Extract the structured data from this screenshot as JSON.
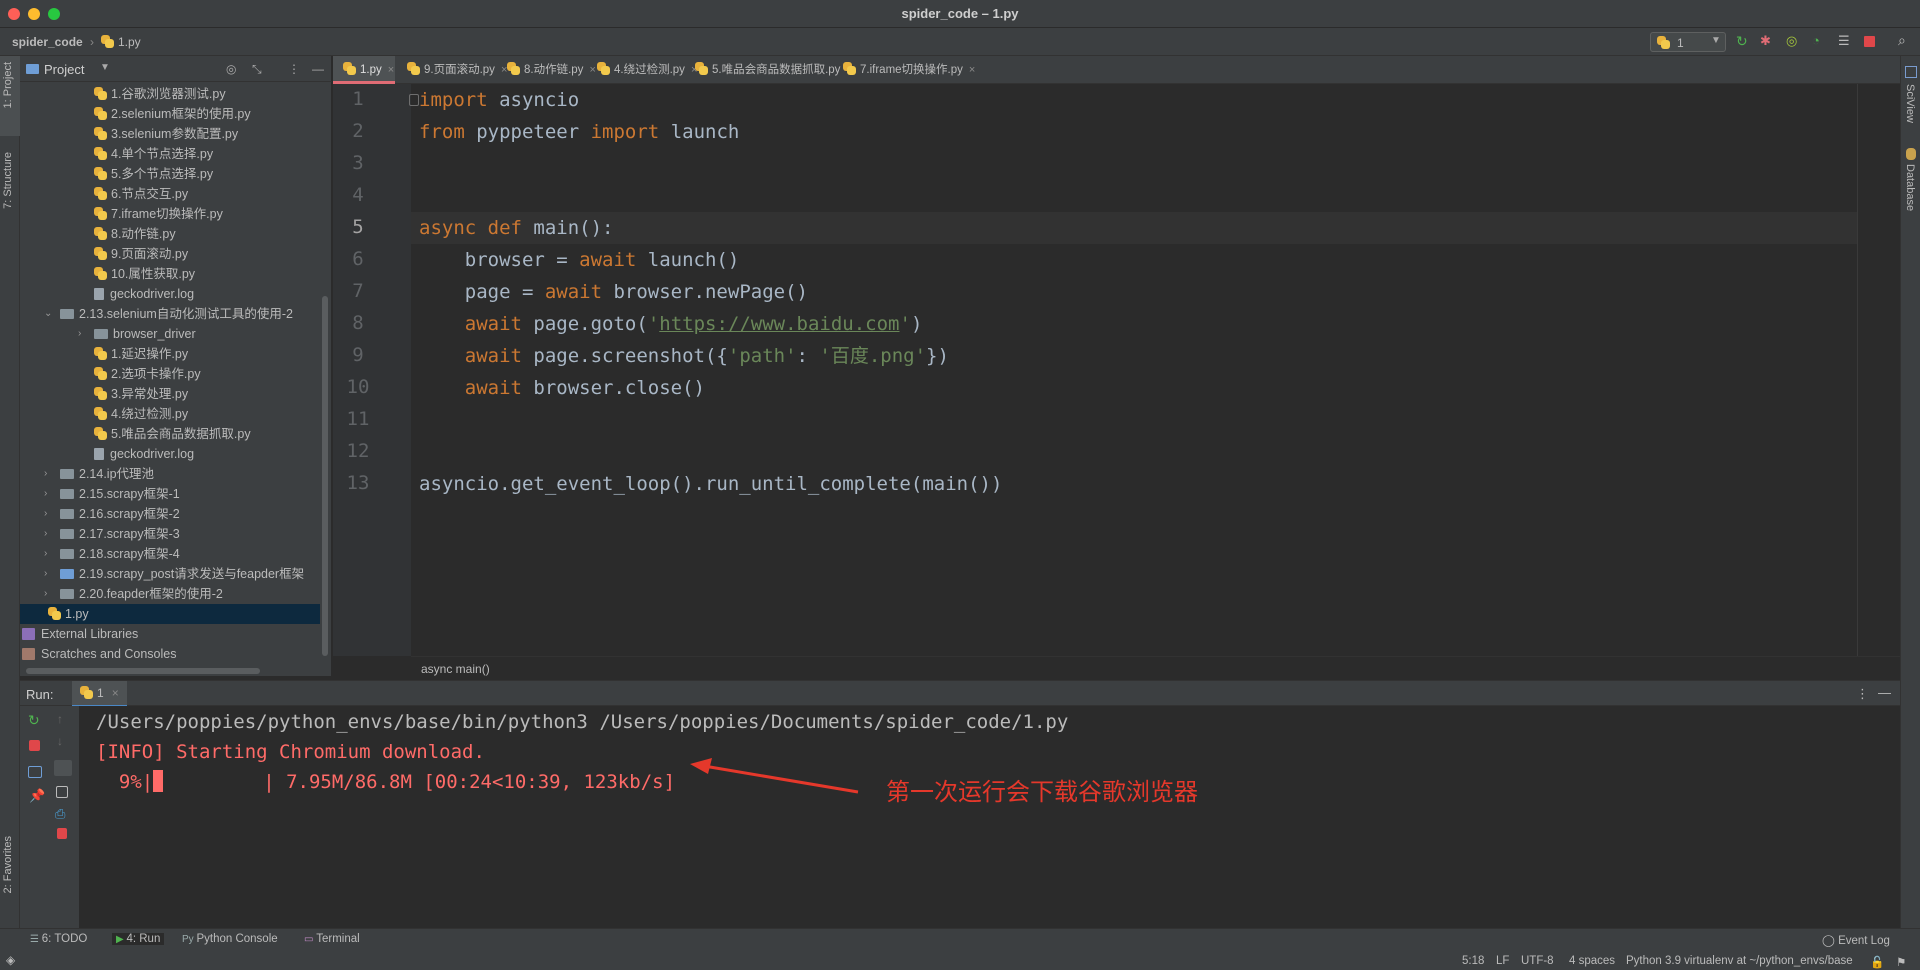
{
  "window": {
    "title": "spider_code – 1.py"
  },
  "navbar": {
    "project": "spider_code",
    "file": "1.py",
    "run_config": "1"
  },
  "project_panel": {
    "title": "Project",
    "items": [
      {
        "label": "1.谷歌浏览器测试.py",
        "kind": "py"
      },
      {
        "label": "2.selenium框架的使用.py",
        "kind": "py"
      },
      {
        "label": "3.selenium参数配置.py",
        "kind": "py"
      },
      {
        "label": "4.单个节点选择.py",
        "kind": "py"
      },
      {
        "label": "5.多个节点选择.py",
        "kind": "py"
      },
      {
        "label": "6.节点交互.py",
        "kind": "py"
      },
      {
        "label": "7.iframe切换操作.py",
        "kind": "py"
      },
      {
        "label": "8.动作链.py",
        "kind": "py"
      },
      {
        "label": "9.页面滚动.py",
        "kind": "py"
      },
      {
        "label": "10.属性获取.py",
        "kind": "py"
      },
      {
        "label": "geckodriver.log",
        "kind": "log"
      },
      {
        "label": "2.13.selenium自动化测试工具的使用-2",
        "kind": "folder-open"
      },
      {
        "label": "browser_driver",
        "kind": "folder"
      },
      {
        "label": "1.延迟操作.py",
        "kind": "py"
      },
      {
        "label": "2.选项卡操作.py",
        "kind": "py"
      },
      {
        "label": "3.异常处理.py",
        "kind": "py"
      },
      {
        "label": "4.绕过检测.py",
        "kind": "py"
      },
      {
        "label": "5.唯品会商品数据抓取.py",
        "kind": "py"
      },
      {
        "label": "geckodriver.log",
        "kind": "log"
      },
      {
        "label": "2.14.ip代理池",
        "kind": "folder"
      },
      {
        "label": "2.15.scrapy框架-1",
        "kind": "folder"
      },
      {
        "label": "2.16.scrapy框架-2",
        "kind": "folder"
      },
      {
        "label": "2.17.scrapy框架-3",
        "kind": "folder"
      },
      {
        "label": "2.18.scrapy框架-4",
        "kind": "folder"
      },
      {
        "label": "2.19.scrapy_post请求发送与feapder框架",
        "kind": "folder-blue"
      },
      {
        "label": "2.20.feapder框架的使用-2",
        "kind": "folder"
      },
      {
        "label": "1.py",
        "kind": "py-selected"
      },
      {
        "label": "External Libraries",
        "kind": "lib"
      },
      {
        "label": "Scratches and Consoles",
        "kind": "scratch"
      }
    ]
  },
  "tabs": [
    {
      "label": "1.py",
      "active": true
    },
    {
      "label": "9.页面滚动.py",
      "active": false
    },
    {
      "label": "8.动作链.py",
      "active": false
    },
    {
      "label": "4.绕过检测.py",
      "active": false
    },
    {
      "label": "5.唯品会商品数据抓取.py",
      "active": false
    },
    {
      "label": "7.iframe切换操作.py",
      "active": false
    }
  ],
  "editor": {
    "line_numbers": [
      "1",
      "2",
      "3",
      "4",
      "5",
      "6",
      "7",
      "8",
      "9",
      "10",
      "11",
      "12",
      "13"
    ],
    "current_line": "5",
    "breadcrumb": "async main()"
  },
  "run": {
    "label": "Run:",
    "tab": "1",
    "cmd": "/Users/poppies/python_envs/base/bin/python3 /Users/poppies/Documents/spider_code/1.py",
    "info": "[INFO] Starting Chromium download.",
    "progress_prefix": "  9%|",
    "progress_suffix": "| 7.95M/86.8M [00:24<10:39, 123kb/s]",
    "progress_fraction": 0.09,
    "annotation": "第一次运行会下载谷歌浏览器"
  },
  "left_strip": {
    "project_tab": "1: Project",
    "structure_tab": "7: Structure",
    "favorites_tab": "2: Favorites"
  },
  "right_strip": {
    "sciview_tab": "SciView",
    "database_tab": "Database"
  },
  "bottom_tabs": [
    {
      "label": "6: TODO"
    },
    {
      "label": "4: Run"
    },
    {
      "label": "Python Console"
    },
    {
      "label": "Terminal"
    }
  ],
  "status": {
    "event_log": "Event Log",
    "position": "5:18",
    "line_sep": "LF",
    "encoding": "UTF-8",
    "indent": "4 spaces",
    "interpreter": "Python 3.9 virtualenv at ~/python_envs/base"
  },
  "colors": {
    "keyword": "#cc7832",
    "string": "#6a8759",
    "error_red": "#ff6b68",
    "annotation_red": "#e5382b"
  }
}
